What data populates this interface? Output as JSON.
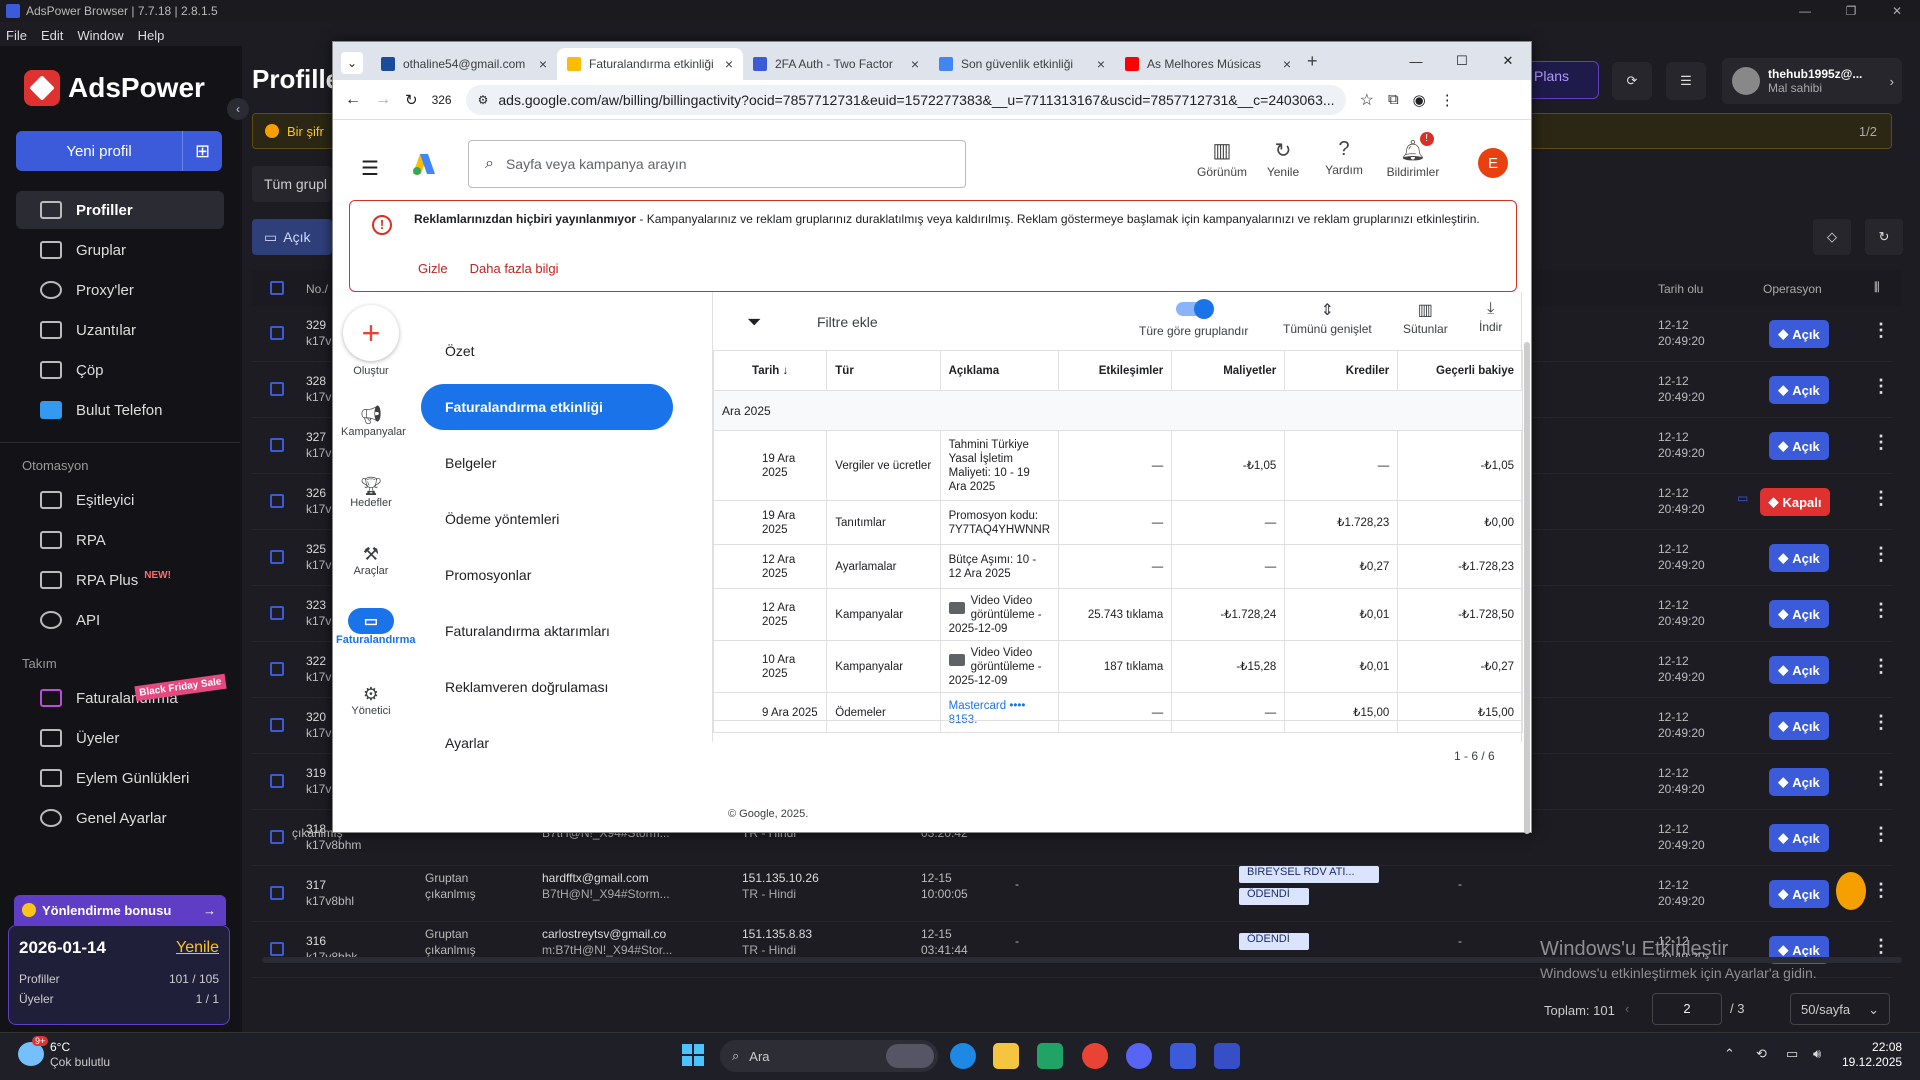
{
  "app": {
    "title": "AdsPower Browser | 7.7.18 | 2.8.1.5",
    "menu": [
      "File",
      "Edit",
      "Window",
      "Help"
    ],
    "logo": "AdsPower",
    "new_profile": "Yeni profil",
    "nav": [
      "Profiller",
      "Gruplar",
      "Proxy'ler",
      "Uzantılar",
      "Çöp",
      "Bulut Telefon"
    ],
    "automation_head": "Otomasyon",
    "automation": [
      "Eşitleyici",
      "RPA",
      "RPA Plus",
      "API"
    ],
    "new_badge": "NEW!",
    "team_head": "Takım",
    "team": [
      "Faturalandırma",
      "Üyeler",
      "Eylem Günlükleri",
      "Genel Ayarlar"
    ],
    "black_friday": "Black Friday Sale",
    "bonus": "Yönlendirme bonusu",
    "card_date": "2026-01-14",
    "card_renew": "Yenile",
    "card_profiles_label": "Profiller",
    "card_profiles_value": "101 / 105",
    "card_members_label": "Üyeler",
    "card_members_value": "1 / 1",
    "bg_title": "Profiller",
    "banner_text": "Bir şifr",
    "groups_btn": "Tüm grupl",
    "open_btn": "Açık",
    "plans": "Plans",
    "user_name": "thehub1995z@...",
    "user_role": "Mal sahibi",
    "page_counter": "1/2",
    "col_no": "No./",
    "col_created": "Tarih olu",
    "col_ops": "Operasyon",
    "acik": "Açık",
    "kapali": "Kapalı",
    "rows": [
      {
        "no": "329",
        "id": "k17v",
        "date": "12-12",
        "time": "20:49:20"
      },
      {
        "no": "328",
        "id": "k17v",
        "date": "12-12",
        "time": "20:49:20"
      },
      {
        "no": "327",
        "id": "k17v",
        "date": "12-12",
        "time": "20:49:20"
      },
      {
        "no": "326",
        "id": "k17v",
        "date": "12-12",
        "time": "20:49:20"
      },
      {
        "no": "325",
        "id": "k17v",
        "date": "12-12",
        "time": "20:49:20"
      },
      {
        "no": "323",
        "id": "k17v",
        "date": "12-12",
        "time": "20:49:20"
      },
      {
        "no": "322",
        "id": "k17v",
        "date": "12-12",
        "time": "20:49:20"
      },
      {
        "no": "320",
        "id": "k17v",
        "date": "12-12",
        "time": "20:49:20"
      },
      {
        "no": "319",
        "id": "k17v",
        "date": "12-12",
        "time": "20:49:20"
      },
      {
        "no": "318",
        "id": "k17v8bhm",
        "date": "12-12",
        "time": "20:49:20"
      },
      {
        "no": "317",
        "id": "k17v8bhl",
        "date": "12-12",
        "time": "20:49:20"
      },
      {
        "no": "316",
        "id": "k17v8bhk",
        "date": "12-12",
        "time": "20:49:20"
      }
    ],
    "row318": {
      "group": "çıkanlmış",
      "acct": "B7tH@N!_X94#Storm...",
      "proxy": "TR - Hindi",
      "time": "03:20:42"
    },
    "row317": {
      "group": "Gruptan",
      "group2": "çıkanlmış",
      "email": "hardfftx@gmail.com",
      "acct": "B7tH@N!_X94#Storm...",
      "ip": "151.135.10.26",
      "loc": "TR - Hindi",
      "date": "12-15",
      "time": "10:00:05",
      "tag1": "BİREYSEL RDV ATI...",
      "tag2": "ÖDENDİ",
      "dash": "-"
    },
    "row316": {
      "group": "Gruptan",
      "group2": "çıkanlmış",
      "email": "carlostreytsv@gmail.co",
      "acct": "m:B7tH@N!_X94#Stor...",
      "ip": "151.135.8.83",
      "loc": "TR - Hindi",
      "date": "12-15",
      "time": "03:41:44",
      "tag2": "ÖDENDİ",
      "dash": "-"
    },
    "total": "Toplam: 101",
    "page": "2",
    "pages": "/ 3",
    "per_page": "50/sayfa",
    "watermark1": "Windows'u Etkinleştir",
    "watermark2": "Windows'u etkinleştirmek için Ayarlar'a gidin."
  },
  "browser": {
    "tabs": [
      {
        "title": "othaline54@gmail.com",
        "color": "#1a4c9c"
      },
      {
        "title": "Faturalandırma etkinliği",
        "color": "#fbbc04"
      },
      {
        "title": "2FA Auth - Two Factor",
        "color": "#3b5bdb"
      },
      {
        "title": "Son güvenlik etkinliği",
        "color": "#4285f4"
      },
      {
        "title": "As Melhores Músicas",
        "color": "#ff0000"
      }
    ],
    "tab_number": "326",
    "url": "ads.google.com/aw/billing/billingactivity?ocid=7857712731&euid=1572277383&__u=7711313167&uscid=7857712731&__c=2403063..."
  },
  "ads": {
    "search_placeholder": "Sayfa veya kampanya arayın",
    "header_btns": [
      "Görünüm",
      "Yenile",
      "Yardım",
      "Bildirimler"
    ],
    "notif_count": "!",
    "avatar": "E",
    "alert_title": "Reklamlarınızdan hiçbiri yayınlanmıyor",
    "alert_body": " - Kampanyalarınız ve reklam gruplarınız duraklatılmış veya kaldırılmış. Reklam göstermeye başlamak için kampanyalarınızı ve reklam gruplarınızı etkinleştirin.",
    "alert_hide": "Gizle",
    "alert_more": "Daha fazla bilgi",
    "left_nav": [
      "Oluştur",
      "Kampanyalar",
      "Hedefler",
      "Araçlar",
      "Faturalandırma",
      "Yönetici"
    ],
    "sub_nav": [
      "Özet",
      "Faturalandırma etkinliği",
      "Belgeler",
      "Ödeme yöntemleri",
      "Promosyonlar",
      "Faturalandırma aktarımları",
      "Reklamveren doğrulaması",
      "Ayarlar"
    ],
    "filter": "Filtre ekle",
    "tools": [
      "Türe göre gruplandır",
      "Tümünü genişlet",
      "Sütunlar",
      "İndir"
    ],
    "columns": [
      "Tarih",
      "Tür",
      "Açıklama",
      "Etkileşimler",
      "Maliyetler",
      "Krediler",
      "Geçerli bakiye"
    ],
    "group_label": "Ara 2025",
    "rows": [
      {
        "date": "19 Ara 2025",
        "type": "Vergiler ve ücretler",
        "desc": "Tahmini Türkiye Yasal İşletim Maliyeti: 10 - 19 Ara 2025",
        "inter": "—",
        "cost": "-₺1,05",
        "credit": "—",
        "bal": "-₺1,05"
      },
      {
        "date": "19 Ara 2025",
        "type": "Tanıtımlar",
        "desc": "Promosyon kodu: 7Y7TAQ4YHWNNR",
        "inter": "—",
        "cost": "—",
        "credit": "₺1.728,23",
        "bal": "₺0,00"
      },
      {
        "date": "12 Ara 2025",
        "type": "Ayarlamalar",
        "desc": "Bütçe Aşımı: 10 - 12 Ara 2025",
        "inter": "—",
        "cost": "—",
        "credit": "₺0,27",
        "bal": "-₺1.728,23"
      },
      {
        "date": "12 Ara 2025",
        "type": "Kampanyalar",
        "desc": "Video Video görüntüleme - 2025-12-09",
        "inter": "25.743 tıklama",
        "cost": "-₺1.728,24",
        "credit": "₺0,01",
        "bal": "-₺1.728,50"
      },
      {
        "date": "10 Ara 2025",
        "type": "Kampanyalar",
        "desc": "Video Video görüntüleme - 2025-12-09",
        "inter": "187 tıklama",
        "cost": "-₺15,28",
        "credit": "₺0,01",
        "bal": "-₺0,27"
      },
      {
        "date": "9 Ara 2025",
        "type": "Ödemeler",
        "desc": "Mastercard •••• 8153.",
        "inter": "—",
        "cost": "—",
        "credit": "₺15,00",
        "bal": "₺15,00"
      }
    ],
    "pager": "1 - 6 / 6",
    "copyright": "© Google, 2025."
  },
  "taskbar": {
    "weather_temp": "6°C",
    "weather_desc": "Çok bulutlu",
    "weather_badge": "9+",
    "search": "Ara",
    "time": "22:08",
    "date": "19.12.2025"
  }
}
